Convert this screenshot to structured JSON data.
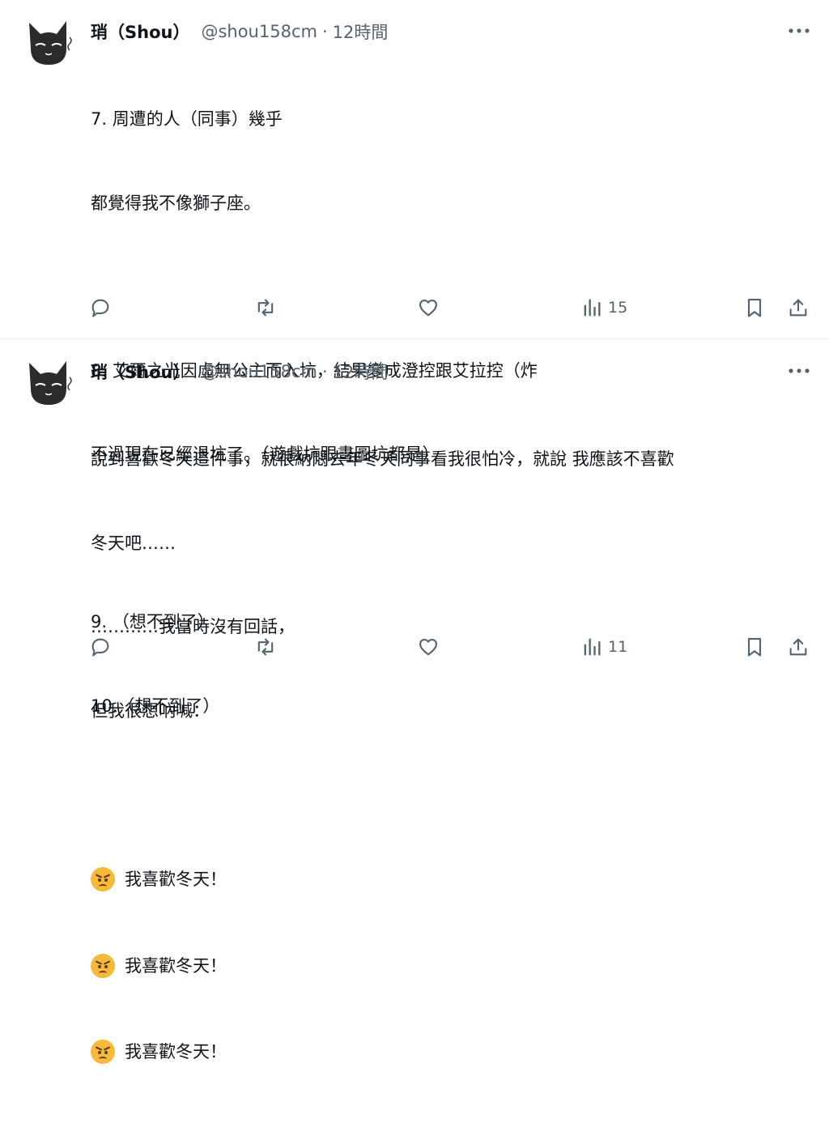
{
  "tweets": [
    {
      "author": {
        "name": "琑（Shou）",
        "handle": "@shou158cm",
        "separator": "·",
        "time": "12時間"
      },
      "lines": [
        "7. 周遭的人（同事）幾乎",
        "都覺得我不像獅子座。",
        "",
        "8. 艾爾之光因虛無公主而入坑，結果變成澄控跟艾拉控（炸",
        "不過現在已經退坑了。（遊戲坑跟畫圖坑都是）",
        "",
        "9. （想不到了）",
        "10.（想不到了）"
      ],
      "views": "15"
    },
    {
      "author": {
        "name": "琑（Shou）",
        "handle": "@shou158cm",
        "separator": "·",
        "time": "12時間"
      },
      "lines": [
        "說到喜歡冬天這件事，就很納悶去年冬天同事看我很怕冷，就說 我應該不喜歡",
        "冬天吧……",
        "…………我當時沒有回話，",
        "但我很想吶喊：",
        ""
      ],
      "emoji_lines": [
        "我喜歡冬天！",
        "我喜歡冬天！",
        "我喜歡冬天！"
      ],
      "views": "11"
    }
  ],
  "icons": {
    "reply": "reply-icon",
    "retweet": "retweet-icon",
    "like": "like-icon",
    "views": "views-icon",
    "bookmark": "bookmark-icon",
    "share": "share-icon",
    "more": "more-icon",
    "emoji": "angry-face-emoji"
  },
  "colors": {
    "text": "#0f1419",
    "secondary": "#536471",
    "divider": "#eff3f4",
    "emoji": "#f6b93b"
  }
}
